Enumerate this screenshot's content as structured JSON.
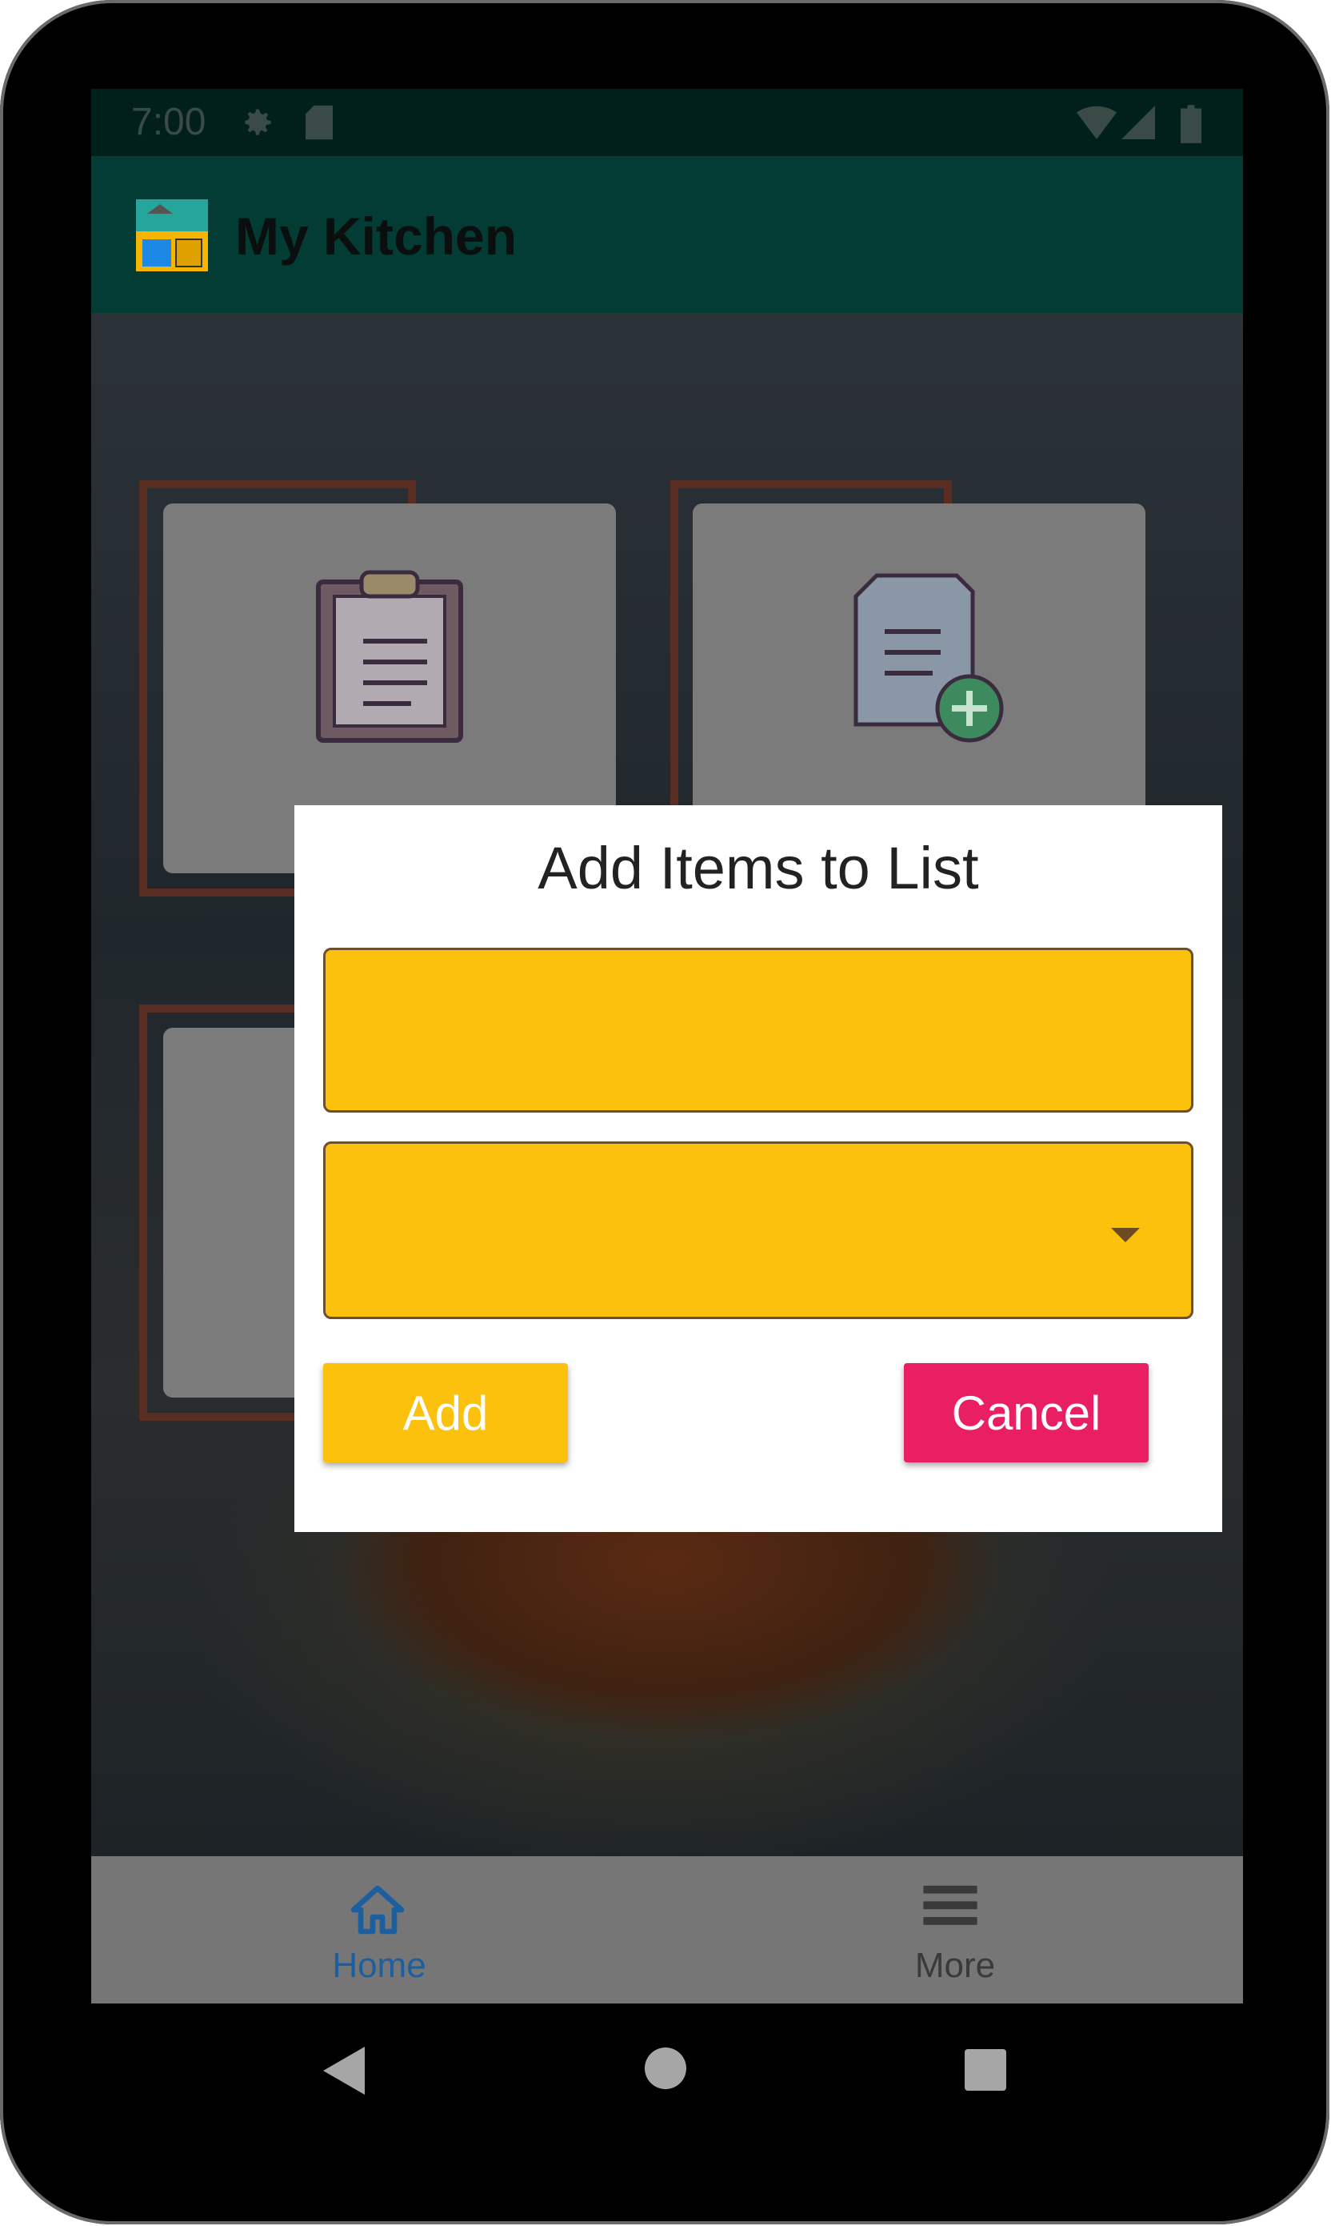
{
  "status_bar": {
    "time": "7:00",
    "icons": [
      "gear-icon",
      "sd-card-icon",
      "wifi-icon",
      "signal-icon",
      "battery-icon"
    ]
  },
  "app_bar": {
    "title": "My Kitchen",
    "logo": "kitchen-cabinet-logo"
  },
  "tiles": [
    {
      "icon": "clipboard-checklist-icon"
    },
    {
      "icon": "add-list-icon"
    },
    {
      "icon": "tile-icon"
    },
    {
      "icon": "tile-icon"
    }
  ],
  "dialog": {
    "title": "Add Items to List",
    "item_input": {
      "value": "",
      "placeholder": ""
    },
    "category_select": {
      "value": ""
    },
    "add_label": "Add",
    "cancel_label": "Cancel",
    "colors": {
      "field": "#fcc10d",
      "add": "#fcc10d",
      "cancel": "#e91e63"
    }
  },
  "bottom_nav": {
    "items": [
      {
        "label": "Home",
        "icon": "home-icon",
        "active": true
      },
      {
        "label": "More",
        "icon": "menu-icon",
        "active": false
      }
    ],
    "active_color": "#1b5fa0"
  }
}
